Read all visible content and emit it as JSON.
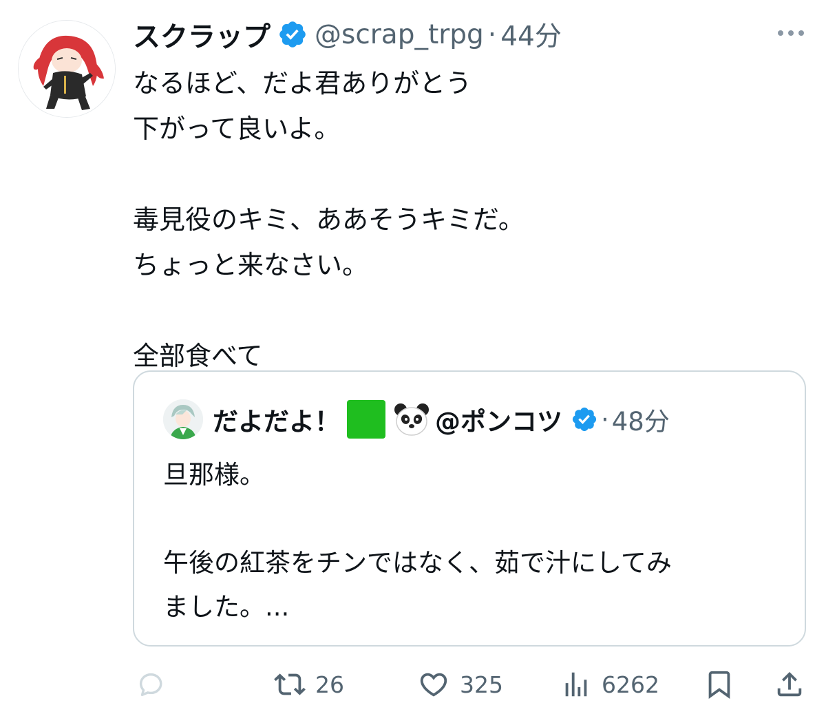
{
  "tweet": {
    "author_name": "スクラップ",
    "handle": "@scrap_trpg",
    "separator": "·",
    "time": "44分",
    "lines": [
      "なるほど、だよ君ありがとう",
      "下がって良いよ。",
      "",
      "毒見役のキミ、ああそうキミだ。",
      "ちょっと来なさい。",
      "",
      "全部食べて"
    ]
  },
  "quote": {
    "author_name": "だよだよ！",
    "handle": "@ポンコツ",
    "separator": "·",
    "time": "48分",
    "lines": [
      "旦那様。",
      "",
      "午後の紅茶をチンではなく、茹で汁にしてみ",
      "ました。..."
    ]
  },
  "actions": {
    "retweet_count": "26",
    "like_count": "325",
    "view_count": "6262"
  },
  "colors": {
    "verified_blue": "#1d9bf0",
    "secondary_text": "#536471",
    "border": "#cfd9de"
  }
}
